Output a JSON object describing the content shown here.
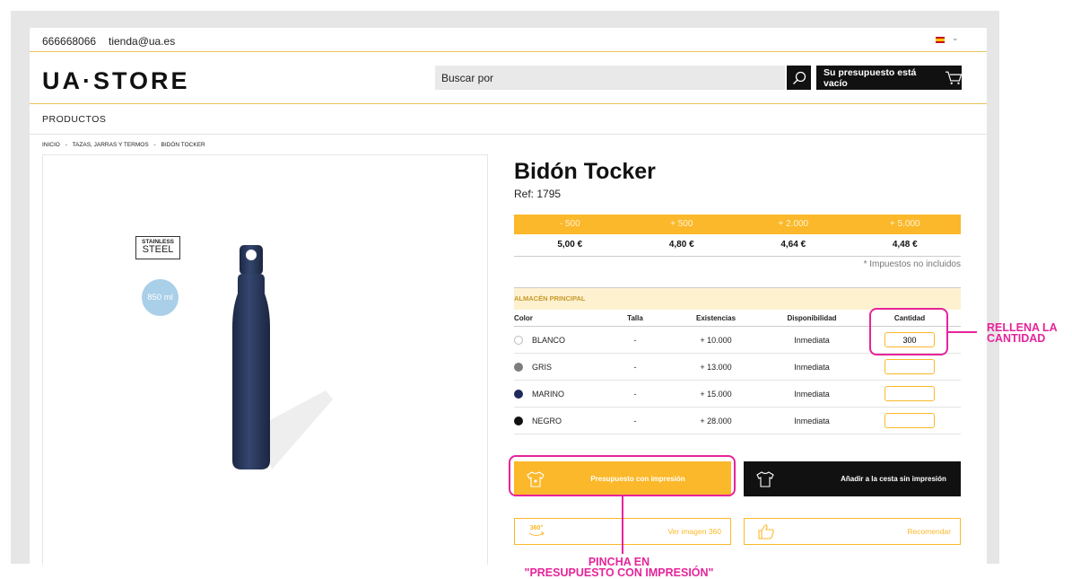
{
  "topbar": {
    "phone": "666668066",
    "email": "tienda@ua.es"
  },
  "header": {
    "logo": "UA·STORE",
    "search_placeholder": "Buscar por",
    "cart_label": "Su presupuesto está vacío"
  },
  "nav": {
    "productos": "PRODUCTOS"
  },
  "breadcrumb": [
    "INICIO",
    "-",
    "TAZAS, JARRAS Y TERMOS",
    "-",
    "BIDÓN TOCKER"
  ],
  "image_badges": {
    "steel_line1": "STAINLESS",
    "steel_line2": "STEEL",
    "capacity": "850 ml"
  },
  "product": {
    "title": "Bidón Tocker",
    "ref": "Ref: 1795"
  },
  "prices": {
    "tiers": [
      "- 500",
      "+ 500",
      "+ 2.000",
      "+ 5.000"
    ],
    "values": [
      "5,00 €",
      "4,80 €",
      "4,64 €",
      "4,48 €"
    ],
    "tax_note": "* Impuestos no incluidos"
  },
  "stock": {
    "warehouse": "ALMACÉN PRINCIPAL",
    "columns": [
      "Color",
      "Talla",
      "Existencias",
      "Disponibilidad",
      "Cantidad"
    ],
    "rows": [
      {
        "color": "BLANCO",
        "swatch": "#ffffff",
        "talla": "-",
        "existencias": "+ 10.000",
        "disponibilidad": "Inmediata",
        "cantidad": "300"
      },
      {
        "color": "GRIS",
        "swatch": "#7d7d7d",
        "talla": "-",
        "existencias": "+ 13.000",
        "disponibilidad": "Inmediata",
        "cantidad": ""
      },
      {
        "color": "MARINO",
        "swatch": "#1f2a5c",
        "talla": "-",
        "existencias": "+ 15.000",
        "disponibilidad": "Inmediata",
        "cantidad": ""
      },
      {
        "color": "NEGRO",
        "swatch": "#111111",
        "talla": "-",
        "existencias": "+ 28.000",
        "disponibilidad": "Inmediata",
        "cantidad": ""
      }
    ]
  },
  "actions": {
    "print_quote": "Presupuesto con impresión",
    "add_cart": "Añadir a la cesta sin impresión",
    "view360_icon_text": "360°",
    "view360": "Ver imagen 360",
    "recommend": "Recomendar"
  },
  "annotations": {
    "qty_line1": "RELLENA LA",
    "qty_line2": "CANTIDAD",
    "click_line1": "PINCHA EN",
    "click_line2": "\"PRESUPUESTO CON IMPRESIÓN\""
  },
  "colors": {
    "accent": "#fbb82a",
    "annotation": "#e6249a",
    "dark": "#111111"
  }
}
